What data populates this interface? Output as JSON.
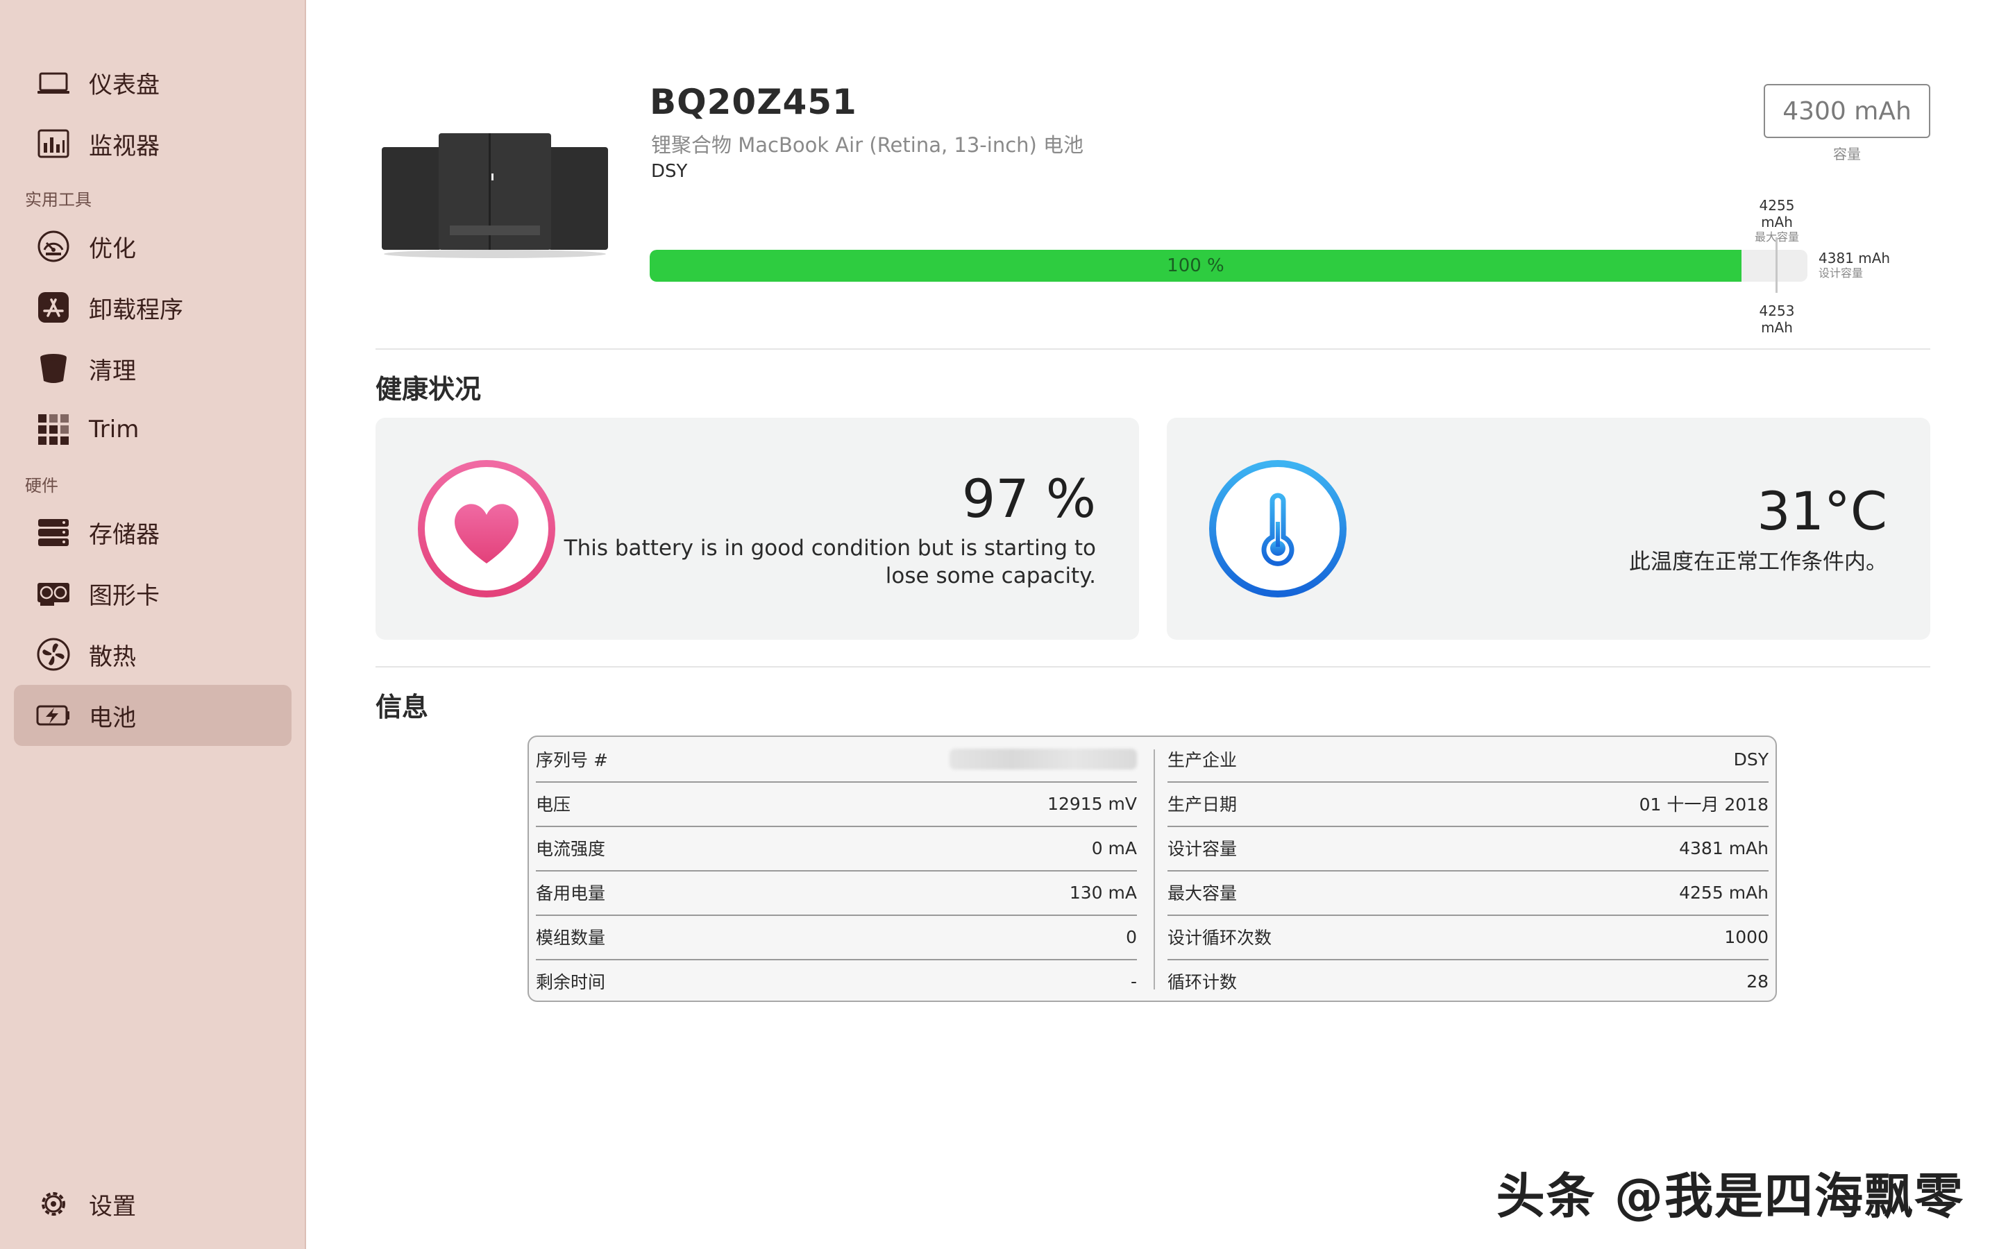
{
  "sidebar": {
    "items": [
      {
        "label": "仪表盘",
        "icon": "laptop-icon"
      },
      {
        "label": "监视器",
        "icon": "chart-monitor-icon"
      }
    ],
    "section_tools": "实用工具",
    "tools": [
      {
        "label": "优化",
        "icon": "speedometer-icon"
      },
      {
        "label": "卸载程序",
        "icon": "app-store-icon"
      },
      {
        "label": "清理",
        "icon": "trash-bucket-icon"
      },
      {
        "label": "Trim",
        "icon": "grid-icon"
      }
    ],
    "section_hardware": "硬件",
    "hardware": [
      {
        "label": "存储器",
        "icon": "storage-icon"
      },
      {
        "label": "图形卡",
        "icon": "graphics-card-icon"
      },
      {
        "label": "散热",
        "icon": "fan-icon"
      },
      {
        "label": "电池",
        "icon": "battery-icon",
        "active": true
      }
    ],
    "settings": {
      "label": "设置",
      "icon": "gear-icon"
    }
  },
  "header": {
    "title": "BQ20Z451",
    "subtitle": "锂聚合物 MacBook Air (Retina, 13-inch) 电池",
    "vendor": "DSY",
    "capacity_value": "4300 mAh",
    "capacity_caption": "容量"
  },
  "charge_bar": {
    "percent_label": "100 %",
    "fill_fraction": 0.943,
    "accent": "#2ecc40",
    "max_capacity": "4255 mAh",
    "max_capacity_caption": "最大容量",
    "design_capacity": "4381 mAh",
    "design_capacity_caption": "设计容量",
    "current_capacity": "4253 mAh"
  },
  "health": {
    "title": "健康状况",
    "battery": {
      "value": "97 %",
      "line1": "This battery is in good condition but is starting to",
      "line2": "lose some capacity.",
      "accent": "#e8467c"
    },
    "temperature": {
      "value": "31°C",
      "description": "此温度在正常工作条件内。",
      "accent": "#1e88e5"
    }
  },
  "info": {
    "title": "信息",
    "left": [
      {
        "label": "序列号 #",
        "value": ""
      },
      {
        "label": "电压",
        "value": "12915 mV"
      },
      {
        "label": "电流强度",
        "value": "0 mA"
      },
      {
        "label": "备用电量",
        "value": "130 mA"
      },
      {
        "label": "模组数量",
        "value": "0"
      },
      {
        "label": "剩余时间",
        "value": "-"
      }
    ],
    "right": [
      {
        "label": "生产企业",
        "value": "DSY"
      },
      {
        "label": "生产日期",
        "value": "01 十一月 2018"
      },
      {
        "label": "设计容量",
        "value": "4381 mAh"
      },
      {
        "label": "最大容量",
        "value": "4255 mAh"
      },
      {
        "label": "设计循环次数",
        "value": "1000"
      },
      {
        "label": "循环计数",
        "value": "28"
      }
    ]
  },
  "watermark": "头条 @我是四海飘零"
}
